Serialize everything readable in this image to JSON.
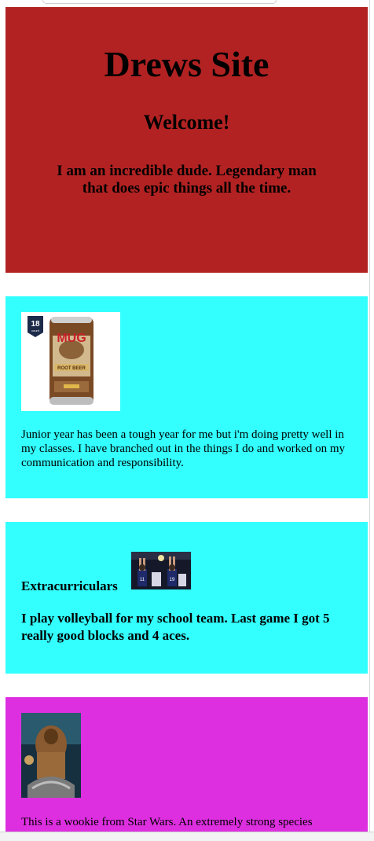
{
  "hero": {
    "title": "Drews Site",
    "subtitle": "Welcome!",
    "tagline": "I am an incredible dude. Legendary man that does epic things all the time.",
    "background": "#b22222"
  },
  "school": {
    "image": {
      "icon": "root-beer-can",
      "badge": "18",
      "badge_sub": "count",
      "brand": "MUG",
      "sub_brand": "ROOT BEER"
    },
    "text": "Junior year has been a tough year for me but i'm doing pretty well in my classes. I have branched out in the things I do and worked on my communication and responsibility.",
    "background": "#33ffff"
  },
  "extracurriculars": {
    "heading": "Extracurriculars",
    "image": {
      "icon": "volleyball-players",
      "jersey_left": "11",
      "jersey_right": "19"
    },
    "text": "I play volleyball for my school team. Last game I got 5 really good blocks and 4 aces.",
    "background": "#33ffff"
  },
  "wookie": {
    "image": {
      "icon": "wookie-warrior"
    },
    "text": "This is a wookie from Star Wars. An extremely strong species",
    "background": "#dd2fe0"
  }
}
